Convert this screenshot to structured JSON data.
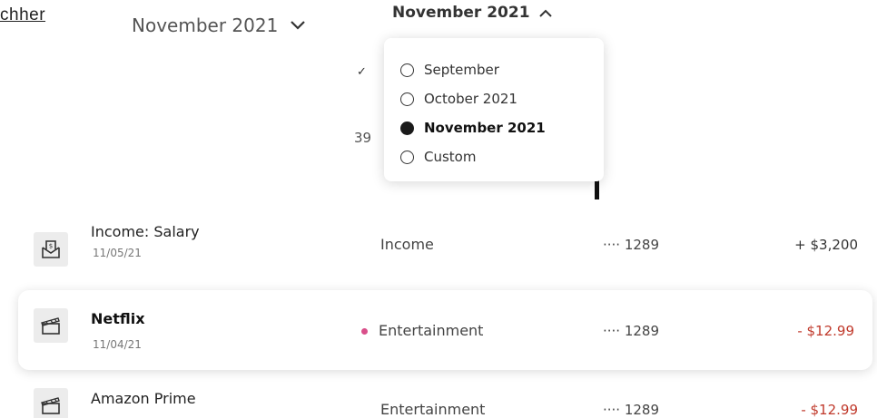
{
  "header": {
    "link_text": "chher",
    "month_select_label": "November 2021",
    "month_toggle_label": "November 2021"
  },
  "dropdown": {
    "options": [
      {
        "label": "September",
        "selected": false
      },
      {
        "label": "October 2021",
        "selected": false
      },
      {
        "label": "November 2021",
        "selected": true
      },
      {
        "label": "Custom",
        "selected": false
      }
    ]
  },
  "background": {
    "partial_check": "✓",
    "partial_number": "39"
  },
  "transactions": [
    {
      "name": "Income: Salary",
      "date": "11/05/21",
      "category": "Income",
      "account": "···· 1289",
      "amount": "+ $3,200",
      "icon": "money-envelope-icon"
    },
    {
      "name": "Netflix",
      "date": "11/04/21",
      "category": "Entertainment",
      "account": "···· 1289",
      "amount": "- $12.99",
      "icon": "clapperboard-icon"
    },
    {
      "name": "Amazon Prime",
      "date": "",
      "category": "Entertainment",
      "account": "···· 1289",
      "amount": "- $12.99",
      "icon": "clapperboard-icon"
    }
  ],
  "colors": {
    "income": "#333333",
    "expense": "#c0392b",
    "category_dot": "#d94f8a"
  }
}
